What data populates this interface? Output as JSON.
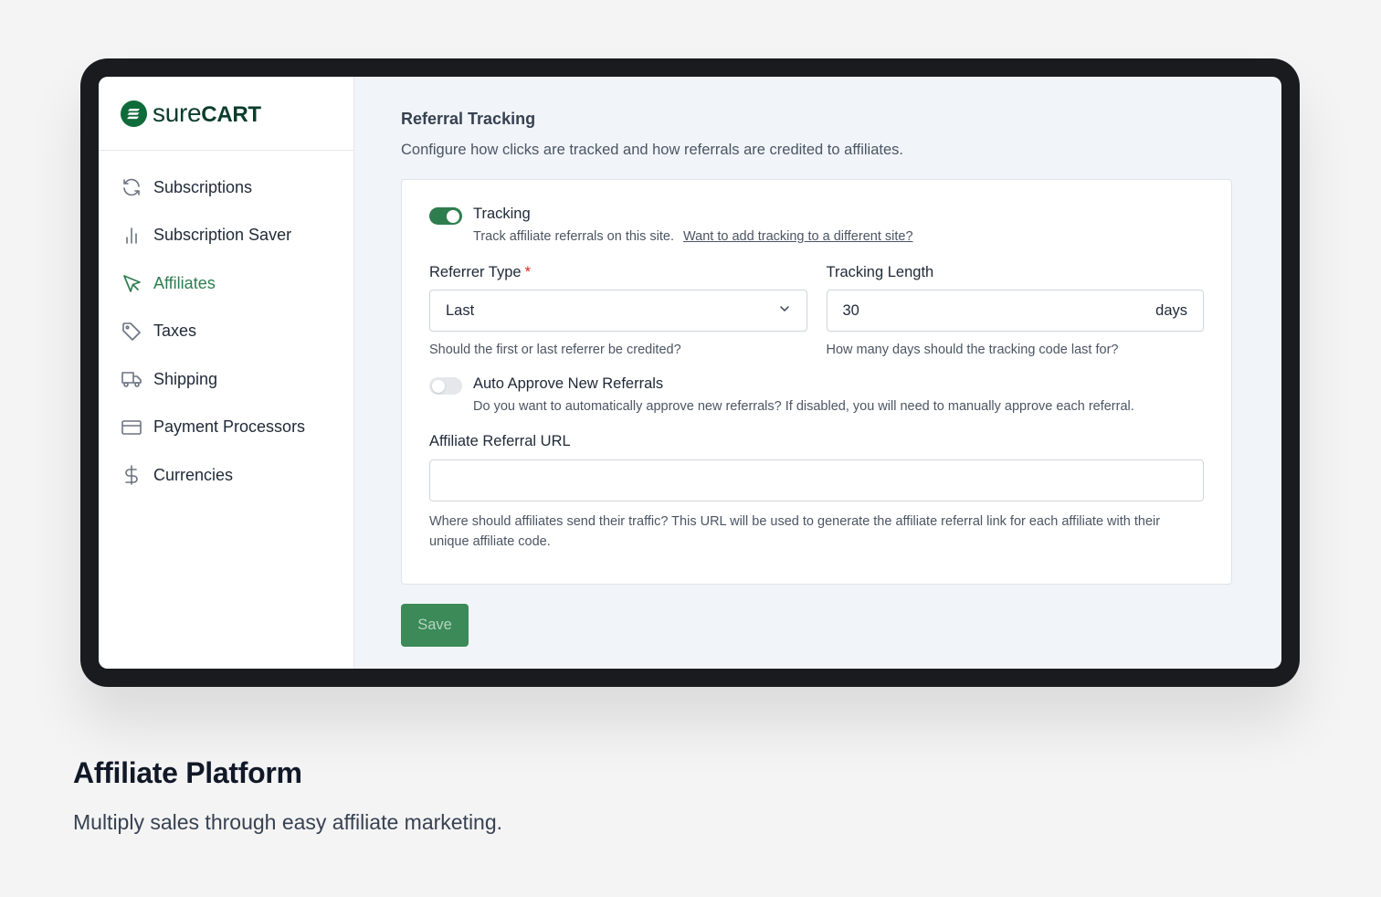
{
  "brand": {
    "logo_text_light": "sure",
    "logo_text_bold": "CART",
    "accent": "#2e7d4f"
  },
  "sidebar": {
    "items": [
      {
        "label": "Subscriptions",
        "icon": "refresh-icon",
        "active": false
      },
      {
        "label": "Subscription Saver",
        "icon": "bar-chart-icon",
        "active": false
      },
      {
        "label": "Affiliates",
        "icon": "cursor-click-icon",
        "active": true
      },
      {
        "label": "Taxes",
        "icon": "tag-icon",
        "active": false
      },
      {
        "label": "Shipping",
        "icon": "truck-icon",
        "active": false
      },
      {
        "label": "Payment Processors",
        "icon": "credit-card-icon",
        "active": false
      },
      {
        "label": "Currencies",
        "icon": "dollar-icon",
        "active": false
      }
    ]
  },
  "main": {
    "title": "Referral Tracking",
    "subtitle": "Configure how clicks are tracked and how referrals are credited to affiliates.",
    "tracking": {
      "label": "Tracking",
      "enabled": true,
      "help": "Track affiliate referrals on this site.",
      "link": "Want to add tracking to a different site?"
    },
    "referrer_type": {
      "label": "Referrer Type",
      "required_mark": "*",
      "value": "Last",
      "help": "Should the first or last referrer be credited?"
    },
    "tracking_length": {
      "label": "Tracking Length",
      "value": "30",
      "suffix": "days",
      "help": "How many days should the tracking code last for?"
    },
    "auto_approve": {
      "label": "Auto Approve New Referrals",
      "enabled": false,
      "help": "Do you want to automatically approve new referrals? If disabled, you will need to manually approve each referral."
    },
    "referral_url": {
      "label": "Affiliate Referral URL",
      "value": "",
      "help": "Where should affiliates send their traffic? This URL will be used to generate the affiliate referral link for each affiliate with their unique affiliate code."
    },
    "save_label": "Save"
  },
  "caption": {
    "title": "Affiliate Platform",
    "subtitle": "Multiply sales through easy affiliate marketing."
  }
}
